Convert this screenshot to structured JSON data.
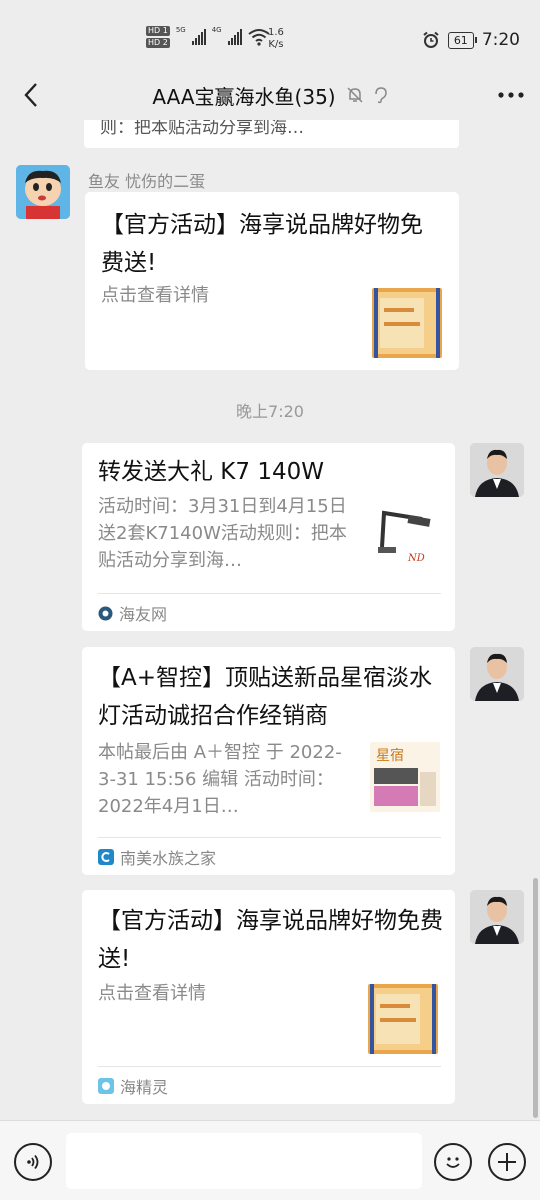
{
  "status_bar": {
    "hd_labels": [
      "HD 1",
      "HD 2"
    ],
    "net_labels": [
      "5G",
      "4G"
    ],
    "speed_value": "1.6",
    "speed_unit": "K/s",
    "battery": "61",
    "time": "7:20"
  },
  "header": {
    "title": "AAA宝赢海水鱼(35)"
  },
  "previous_card": {
    "text": "则：把本贴活动分享到海…"
  },
  "timestamp": "晚上7:20",
  "messages": [
    {
      "sender": "鱼友 忧伤的二蛋",
      "title": "【官方活动】海享说品牌好物免费送!",
      "desc": "点击查看详情",
      "source": ""
    },
    {
      "sender": "",
      "title": "转发送大礼 K7 140W",
      "desc": "活动时间：3月31日到4月15日送2套K7140W活动规则：把本贴活动分享到海…",
      "source": "海友网"
    },
    {
      "sender": "",
      "title": "【A+智控】顶贴送新品星宿淡水灯活动诚招合作经销商",
      "desc": "本帖最后由 A＋智控 于 2022-3-31 15:56 编辑 活动时间：2022年4月1日…",
      "source": "南美水族之家"
    },
    {
      "sender": "",
      "title": "【官方活动】海享说品牌好物免费送!",
      "desc": "点击查看详情",
      "source": "海精灵"
    }
  ],
  "thumbs": {
    "xingsu_text": "星宿",
    "k7_brand": "ND"
  },
  "icons": {
    "back": "chevron-left-icon",
    "mute": "bell-off-icon",
    "ear": "ear-icon",
    "more": "more-dots-icon",
    "voice": "voice-icon",
    "emoji": "emoji-icon",
    "plus": "plus-icon"
  },
  "colors": {
    "background": "#ededed",
    "card": "#ffffff",
    "muted_text": "#8a8a8a"
  }
}
